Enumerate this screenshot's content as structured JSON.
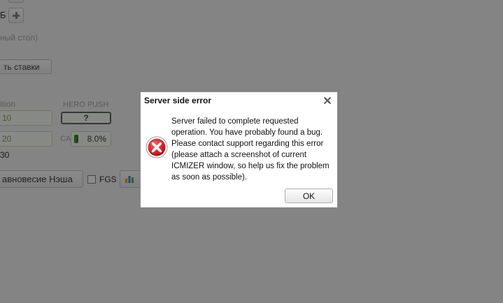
{
  "background": {
    "top_label": "Б",
    "desktop_hint": "ный стол)",
    "stakes_button": "ть ставки",
    "position_label": "ition",
    "field_10": "10",
    "field_20": "20",
    "hero_push_label": "HERO PUSH",
    "hero_push_value": "?",
    "ca_label": "CA",
    "ca_percent": "8.0%",
    "value_30": "30",
    "nash_button": "авновесие Нэша",
    "fgs_label": "FGS",
    "ca_bar_color": "#3a8a2e"
  },
  "dialog": {
    "title": "Server side error",
    "message": "Server failed to complete requested operation. You have probably found a bug. Please contact support regarding this error (please attach a screenshot of current ICMIZER window, so help us fix the problem as soon as possible).",
    "ok_label": "OK",
    "icon": "error-icon",
    "close_icon": "close-icon",
    "error_color": "#d4262c"
  }
}
